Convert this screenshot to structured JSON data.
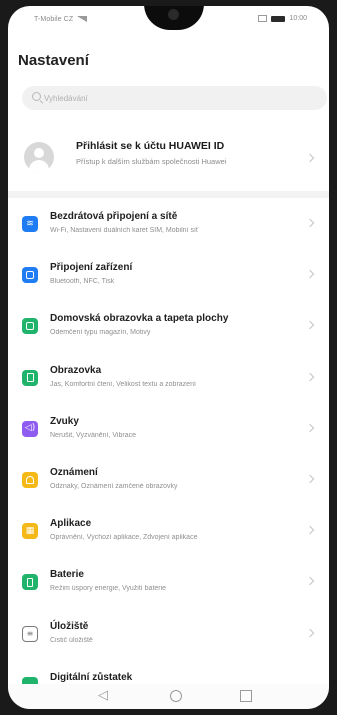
{
  "status_bar": {
    "carrier": "T-Mobile CZ",
    "time": "10:00"
  },
  "header": {
    "title": "Nastavení"
  },
  "search": {
    "placeholder": "Vyhledávání"
  },
  "account": {
    "title": "Přihlásit se k účtu HUAWEI ID",
    "subtitle": "Přístup k dalším službám společnosti Huawei"
  },
  "settings": {
    "items": [
      {
        "title": "Bezdrátová připojení a sítě",
        "subtitle": "Wi-Fi, Nastavení duálních karet SIM, Mobilní síť",
        "icon": "wifi-icon",
        "color": "#1f7cf2"
      },
      {
        "title": "Připojení zařízení",
        "subtitle": "Bluetooth, NFC, Tisk",
        "icon": "device-connection-icon",
        "color": "#1f7cf2"
      },
      {
        "title": "Domovská obrazovka a tapeta plochy",
        "subtitle": "Odemčení typu magazín, Motivy",
        "icon": "wallpaper-icon",
        "color": "#1fb36b"
      },
      {
        "title": "Obrazovka",
        "subtitle": "Jas, Komfortní čtení, Velikost textu a zobrazení",
        "icon": "display-icon",
        "color": "#1fb36b"
      },
      {
        "title": "Zvuky",
        "subtitle": "Nerušit, Vyzvánění, Vibrace",
        "icon": "sound-icon",
        "color": "#8e5cf0"
      },
      {
        "title": "Oznámení",
        "subtitle": "Odznaky, Oznámení zamčené obrazovky",
        "icon": "notification-icon",
        "color": "#f5b917"
      },
      {
        "title": "Aplikace",
        "subtitle": "Oprávnění, Výchozí aplikace, Zdvojení aplikace",
        "icon": "apps-icon",
        "color": "#f5b917"
      },
      {
        "title": "Baterie",
        "subtitle": "Režim úspory energie, Využití baterie",
        "icon": "battery-icon",
        "color": "#1fb36b"
      },
      {
        "title": "Úložiště",
        "subtitle": "Čistič úložiště",
        "icon": "storage-icon",
        "color": "#7a7a7a"
      },
      {
        "title": "Digitální zůstatek",
        "subtitle": "",
        "icon": "digital-balance-icon",
        "color": "#1fb36b"
      }
    ]
  },
  "navbar": {
    "back_icon": "back-triangle-icon",
    "home_icon": "home-circle-icon",
    "recent_icon": "recent-square-icon"
  }
}
